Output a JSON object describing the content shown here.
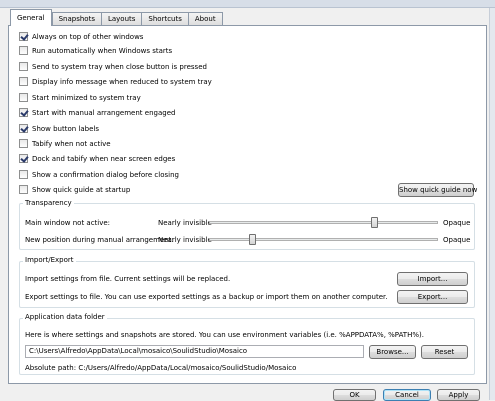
{
  "tabs": [
    {
      "label": "General"
    },
    {
      "label": "Snapshots"
    },
    {
      "label": "Layouts"
    },
    {
      "label": "Shortcuts"
    },
    {
      "label": "About"
    }
  ],
  "options": [
    {
      "label": "Always on top of other windows",
      "checked": true
    },
    {
      "label": "Run automatically when Windows starts",
      "checked": false
    },
    {
      "label": "Send to system tray when close button is pressed",
      "checked": false
    },
    {
      "label": "Display info message when reduced to system tray",
      "checked": false
    },
    {
      "label": "Start minimized to system tray",
      "checked": false
    },
    {
      "label": "Start with manual arrangement engaged",
      "checked": true
    },
    {
      "label": "Show button labels",
      "checked": true
    },
    {
      "label": "Tabify when not active",
      "checked": false
    },
    {
      "label": "Dock and tabify when near screen edges",
      "checked": true
    },
    {
      "label": "Show a confirmation dialog before closing",
      "checked": false
    },
    {
      "label": "Show quick guide at startup",
      "checked": false
    }
  ],
  "show_quick_guide_button": "Show quick guide now",
  "transparency": {
    "title": "Transparency",
    "rows": [
      {
        "label": "Main window not active:",
        "min_label": "Nearly invisible",
        "max_label": "Opaque",
        "level": 0.73
      },
      {
        "label": "New position during manual arrangement:",
        "min_label": "Nearly invisible",
        "max_label": "Opaque",
        "level": 0.18
      }
    ]
  },
  "import_export": {
    "title": "Import/Export",
    "import_text": "Import settings from file. Current settings will be replaced.",
    "import_button": "Import...",
    "export_text": "Export settings to file. You can use exported settings as a backup or import them on another computer.",
    "export_button": "Export..."
  },
  "app_data": {
    "title": "Application data folder",
    "description": "Here is where settings and snapshots are stored. You can use environment variables (i.e. %APPDATA%, %PATH%).",
    "path_value": "C:\\Users\\Alfredo\\AppData\\Local\\mosaico\\SoulidStudio\\Mosaico",
    "browse_button": "Browse...",
    "reset_button": "Reset",
    "absolute_path": "Absolute path: C:/Users/Alfredo/AppData/Local/mosaico/SoulidStudio/Mosaico"
  },
  "footer": {
    "ok": "OK",
    "cancel": "Cancel",
    "apply": "Apply"
  }
}
